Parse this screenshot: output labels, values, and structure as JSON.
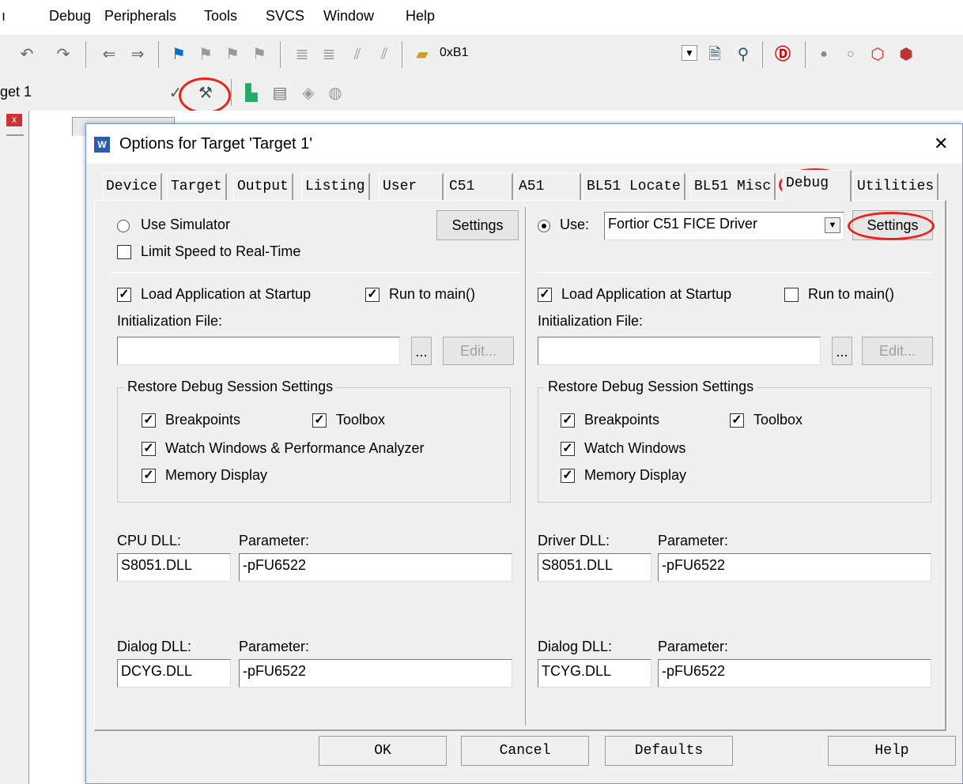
{
  "menu": {
    "partial": "ı",
    "items": [
      "Debug",
      "Peripherals",
      "Tools",
      "SVCS",
      "Window",
      "Help"
    ]
  },
  "toolbar1": {
    "target_value": "0xB1"
  },
  "toolbar2": {
    "target_name": "get 1"
  },
  "dialog": {
    "title": "Options for Target 'Target 1'",
    "close_glyph": "✕",
    "tabs": [
      "Device",
      "Target",
      "Output",
      "Listing",
      "User",
      "C51",
      "A51",
      "BL51 Locate",
      "BL51 Misc",
      "Debug",
      "Utilities"
    ],
    "active_tab": "Debug",
    "left": {
      "use_simulator": "Use Simulator",
      "settings": "Settings",
      "limit_speed": "Limit Speed to Real-Time",
      "load_app": "Load Application at Startup",
      "run_to_main": "Run to main()",
      "init_file_label": "Initialization File:",
      "init_file_value": "",
      "browse": "...",
      "edit": "Edit...",
      "restore_title": "Restore Debug Session Settings",
      "breakpoints": "Breakpoints",
      "toolbox": "Toolbox",
      "watch": "Watch Windows & Performance Analyzer",
      "memory": "Memory Display",
      "cpu_dll_label": "CPU DLL:",
      "cpu_param_label": "Parameter:",
      "cpu_dll": "S8051.DLL",
      "cpu_param": "-pFU6522",
      "dialog_dll_label": "Dialog DLL:",
      "dialog_param_label": "Parameter:",
      "dialog_dll": "DCYG.DLL",
      "dialog_param": "-pFU6522"
    },
    "right": {
      "use": "Use:",
      "driver": "Fortior C51 FICE Driver",
      "settings": "Settings",
      "load_app": "Load Application at Startup",
      "run_to_main": "Run to main()",
      "init_file_label": "Initialization File:",
      "init_file_value": "",
      "browse": "...",
      "edit": "Edit...",
      "restore_title": "Restore Debug Session Settings",
      "breakpoints": "Breakpoints",
      "toolbox": "Toolbox",
      "watch": "Watch Windows",
      "memory": "Memory Display",
      "driver_dll_label": "Driver DLL:",
      "driver_param_label": "Parameter:",
      "driver_dll": "S8051.DLL",
      "driver_param": "-pFU6522",
      "dialog_dll_label": "Dialog DLL:",
      "dialog_param_label": "Parameter:",
      "dialog_dll": "TCYG.DLL",
      "dialog_param": "-pFU6522"
    },
    "buttons": {
      "ok": "OK",
      "cancel": "Cancel",
      "defaults": "Defaults",
      "help": "Help"
    }
  },
  "colors": {
    "annotation": "#e8231c",
    "dialog_border": "#6f9dd6"
  }
}
